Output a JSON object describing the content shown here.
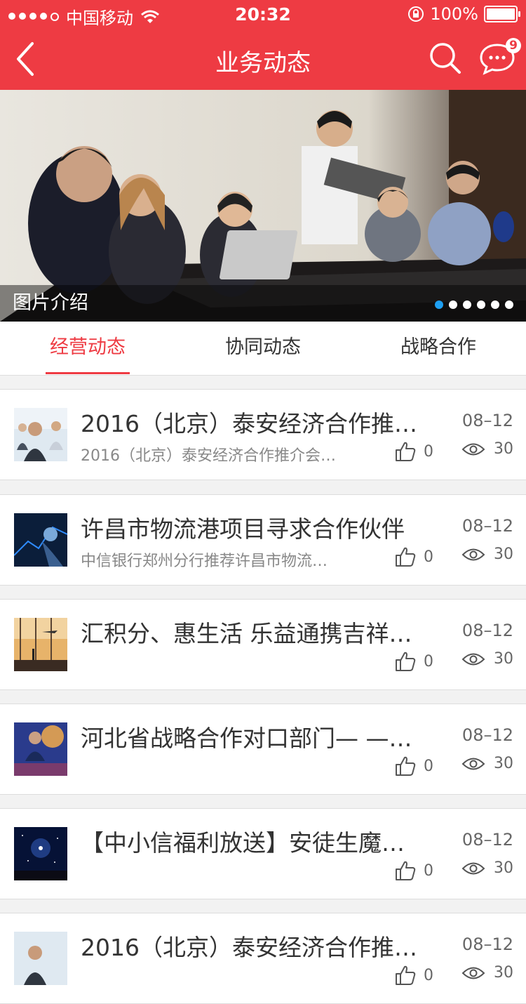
{
  "status": {
    "carrier": "中国移动",
    "time": "20:32",
    "battery": "100%",
    "battery_level": 1.0
  },
  "nav": {
    "title": "业务动态",
    "badge": "9"
  },
  "banner": {
    "caption": "图片介绍",
    "pages": 6,
    "active_page": 0
  },
  "tabs": [
    {
      "label": "经营动态",
      "active": true
    },
    {
      "label": "协同动态",
      "active": false
    },
    {
      "label": "战略合作",
      "active": false
    }
  ],
  "items": [
    {
      "title": "2016（北京）泰安经济合作推…",
      "summary": "2016（北京）泰安经济合作推介会…",
      "date": "08–12",
      "likes": "0",
      "views": "30",
      "thumb": "business-meeting"
    },
    {
      "title": "许昌市物流港项目寻求合作伙伴",
      "summary": "中信银行郑州分行推荐许昌市物流…",
      "date": "08–12",
      "likes": "0",
      "views": "30",
      "thumb": "tech-hand"
    },
    {
      "title": "汇积分、惠生活 乐益通携吉祥…",
      "summary": "",
      "date": "08–12",
      "likes": "0",
      "views": "30",
      "thumb": "airport-plane"
    },
    {
      "title": "河北省战略合作对口部门— —…",
      "summary": "",
      "date": "08–12",
      "likes": "0",
      "views": "30",
      "thumb": "conference-speaker"
    },
    {
      "title": "【中小信福利放送】安徒生魔…",
      "summary": "",
      "date": "08–12",
      "likes": "0",
      "views": "30",
      "thumb": "starry-sky"
    },
    {
      "title": "2016（北京）泰安经济合作推…",
      "summary": "",
      "date": "08–12",
      "likes": "0",
      "views": "30",
      "thumb": "business-meeting"
    }
  ],
  "colors": {
    "accent": "#ee3b43",
    "pager_active": "#1e9ff2"
  }
}
